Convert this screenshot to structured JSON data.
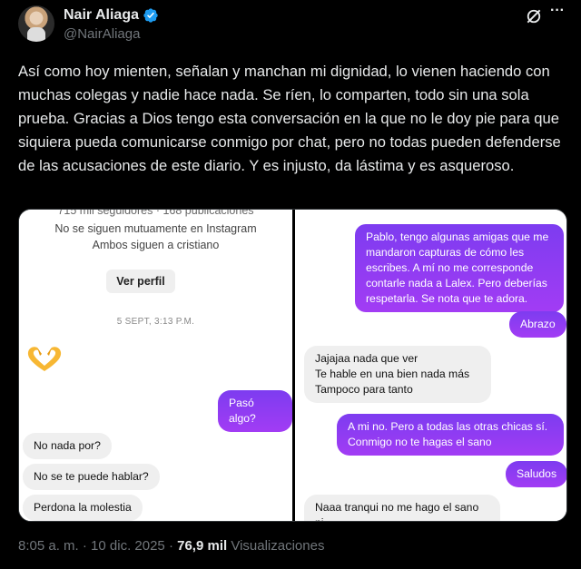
{
  "author": {
    "name": "Nair Aliaga",
    "handle": "@NairAliaga",
    "verified_color": "#1d9bf0"
  },
  "tweet": {
    "text": "Así como hoy mienten, señalan y manchan mi dignidad, lo vienen haciendo con muchas colegas y nadie hace nada. Se ríen, lo comparten, todo sin una sola prueba. Gracias a Dios tengo esta conversación en la que no le doy pie para que siquiera pueda comunicarse conmigo por chat, pero no todas pueden defenderse de las acusaciones de este diario. Y es injusto, da lástima y es asqueroso."
  },
  "left_chat": {
    "profile_cut": "715 mil seguidores · 168 publicaciones",
    "mutual": "No se siguen mutuamente en Instagram",
    "both_follow": "Ambos siguen a cristiano",
    "view_profile": "Ver perfil",
    "date": "5 SEPT, 3:13 P.M.",
    "heart_emoji": "heart-hands-emoji",
    "messages": [
      {
        "dir": "out",
        "text": "Pasó algo?"
      },
      {
        "dir": "in",
        "text": "No nada por?"
      },
      {
        "dir": "in",
        "text": "No se te puede hablar?"
      },
      {
        "dir": "in",
        "text": "Perdona la molestia"
      }
    ]
  },
  "right_chat": {
    "messages": [
      {
        "dir": "out",
        "text": "Pablo, tengo algunas amigas que me mandaron capturas de cómo les escribes. A mí no me corresponde contarle nada a Lalex. Pero deberías respetarla. Se nota que te adora."
      },
      {
        "dir": "out",
        "text": "Abrazo"
      },
      {
        "dir": "in",
        "text": "Jajajaa nada que ver\nTe hable en una bien nada más\nTampoco para tanto"
      },
      {
        "dir": "out",
        "text": "A mi no. Pero a todas las otras chicas sí.\nConmigo no te hagas el sano"
      },
      {
        "dir": "out",
        "text": "Saludos"
      },
      {
        "dir": "in",
        "text": "Naaa tranqui no me hago el sano ni\nnada por el estilo"
      }
    ]
  },
  "footer": {
    "time": "8:05 a. m.",
    "sep1": "·",
    "date": "10 dic. 2025",
    "sep2": "·",
    "views_count": "76,9 mil",
    "views_label": "Visualizaciones"
  },
  "colors": {
    "background": "#000000",
    "text": "#e7e9ea",
    "muted": "#71767b",
    "bubble_out": "#8a30f0",
    "bubble_in": "#efefef"
  }
}
